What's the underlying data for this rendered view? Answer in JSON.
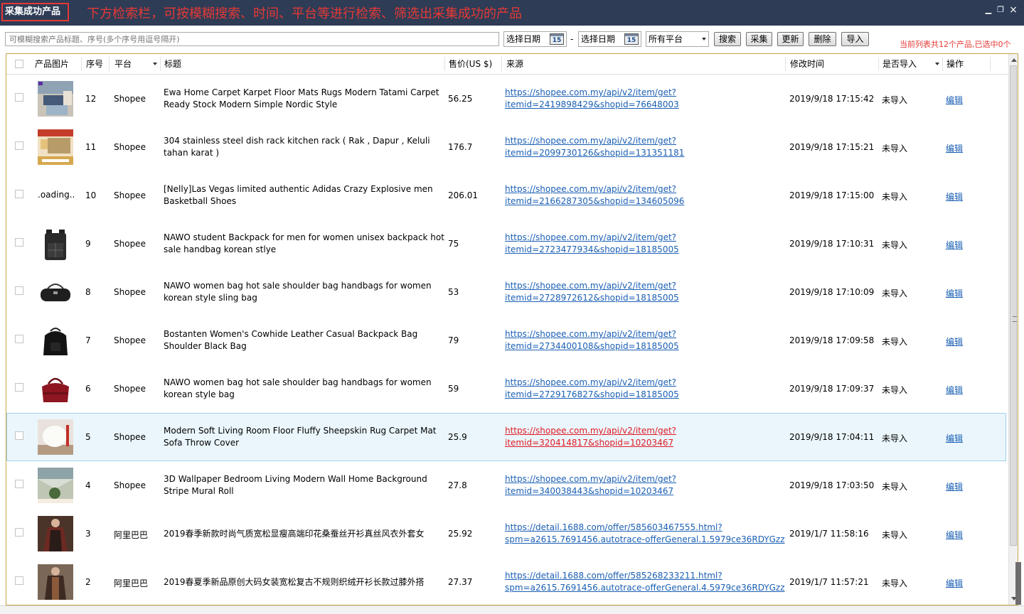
{
  "window": {
    "title": "采集成功产品",
    "annotation": "下方检索栏，可按模糊搜索、时间、平台等进行检索、筛选出采集成功的产品",
    "controls": {
      "close": "×",
      "restore": "❐",
      "minimize": "▁"
    }
  },
  "toolbar": {
    "search_placeholder": "可模糊搜索产品标题、序号(多个序号用逗号隔开)",
    "start_date_label": "选择日期",
    "end_date_label": "选择日期",
    "calendar_day": "15",
    "date_separator": "-",
    "platform_selected": "所有平台",
    "buttons": {
      "search": "搜索",
      "collect": "采集",
      "update": "更新",
      "delete": "删除",
      "import": "导入"
    },
    "status_text": "当前列表共12个产品,已选中0个"
  },
  "table": {
    "headers": {
      "image": "产品图片",
      "index": "序号",
      "platform": "平台",
      "title": "标题",
      "price": "售价(US $)",
      "source": "来源",
      "modified": "修改时间",
      "imported": "是否导入",
      "action": "操作"
    },
    "loading_text": ".oading..",
    "rows": [
      {
        "index": "12",
        "platform": "Shopee",
        "title": "Ewa Home Carpet Karpet Floor Mats Rugs Modern Tatami Carpet Ready Stock Modern Simple Nordic Style",
        "price": "56.25",
        "link1": "https://shopee.com.my/api/v2/item/get?",
        "link2": "itemid=2419898429&shopid=76648003",
        "modified": "2019/9/18 17:15:42",
        "imported": "未导入",
        "action": "编辑"
      },
      {
        "index": "11",
        "platform": "Shopee",
        "title": "304 stainless steel dish rack kitchen rack ( Rak , Dapur , Keluli tahan karat )",
        "price": "176.7",
        "link1": "https://shopee.com.my/api/v2/item/get?",
        "link2": "itemid=2099730126&shopid=131351181",
        "modified": "2019/9/18 17:15:21",
        "imported": "未导入",
        "action": "编辑"
      },
      {
        "index": "10",
        "platform": "Shopee",
        "title": "[Nelly]Las Vegas limited authentic Adidas Crazy Explosive men Basketball Shoes",
        "price": "206.01",
        "link1": "https://shopee.com.my/api/v2/item/get?",
        "link2": "itemid=2166287305&shopid=134605096",
        "modified": "2019/9/18 17:15:00",
        "imported": "未导入",
        "action": "编辑"
      },
      {
        "index": "9",
        "platform": "Shopee",
        "title": "NAWO student Backpack for men for women unisex backpack hot sale handbag korean stlye",
        "price": "75",
        "link1": "https://shopee.com.my/api/v2/item/get?",
        "link2": "itemid=2723477934&shopid=18185005",
        "modified": "2019/9/18 17:10:31",
        "imported": "未导入",
        "action": "编辑"
      },
      {
        "index": "8",
        "platform": "Shopee",
        "title": "NAWO women bag hot sale shoulder bag handbags for women korean style sling bag",
        "price": "53",
        "link1": "https://shopee.com.my/api/v2/item/get?",
        "link2": "itemid=2728972612&shopid=18185005",
        "modified": "2019/9/18 17:10:09",
        "imported": "未导入",
        "action": "编辑"
      },
      {
        "index": "7",
        "platform": "Shopee",
        "title": "Bostanten Women's Cowhide Leather Casual Backpack Bag Shoulder Black Bag",
        "price": "79",
        "link1": "https://shopee.com.my/api/v2/item/get?",
        "link2": "itemid=2734400108&shopid=18185005",
        "modified": "2019/9/18 17:09:58",
        "imported": "未导入",
        "action": "编辑"
      },
      {
        "index": "6",
        "platform": "Shopee",
        "title": "NAWO women bag hot sale shoulder bag handbags for women korean style bag",
        "price": "59",
        "link1": "https://shopee.com.my/api/v2/item/get?",
        "link2": "itemid=2729176827&shopid=18185005",
        "modified": "2019/9/18 17:09:37",
        "imported": "未导入",
        "action": "编辑"
      },
      {
        "index": "5",
        "platform": "Shopee",
        "title": "Modern Soft Living Room Floor Fluffy Sheepskin Rug Carpet Mat Sofa Throw Cover",
        "price": "25.9",
        "link1": "https://shopee.com.my/api/v2/item/get?",
        "link2": "itemid=320414817&shopid=10203467",
        "modified": "2019/9/18 17:04:11",
        "imported": "未导入",
        "action": "编辑"
      },
      {
        "index": "4",
        "platform": "Shopee",
        "title": "3D Wallpaper Bedroom Living Modern Wall Home Background Stripe Mural Roll",
        "price": "27.8",
        "link1": "https://shopee.com.my/api/v2/item/get?",
        "link2": "itemid=340038443&shopid=10203467",
        "modified": "2019/9/18 17:03:50",
        "imported": "未导入",
        "action": "编辑"
      },
      {
        "index": "3",
        "platform": "阿里巴巴",
        "title": "2019春季新款时尚气质宽松显瘦高端印花桑蚕丝开衫真丝风衣外套女",
        "price": "25.92",
        "link1": "https://detail.1688.com/offer/585603467555.html?",
        "link2": "spm=a2615.7691456.autotrace-offerGeneral.1.5979ce36RDYGzz",
        "modified": "2019/1/7 11:58:16",
        "imported": "未导入",
        "action": "编辑"
      },
      {
        "index": "2",
        "platform": "阿里巴巴",
        "title": "2019春夏季新品原创大码女装宽松复古不规则织绒开衫长款过膝外搭",
        "price": "27.37",
        "link1": "https://detail.1688.com/offer/585268233211.html?",
        "link2": "spm=a2615.7691456.autotrace-offerGeneral.4.5979ce36RDYGzz",
        "modified": "2019/1/7 11:57:21",
        "imported": "未导入",
        "action": "编辑"
      }
    ]
  },
  "colors": {
    "titlebar": "#2e3c56",
    "accent_red": "#e53935",
    "link": "#1a5fb4",
    "selected_row": "#eaf6fc"
  }
}
